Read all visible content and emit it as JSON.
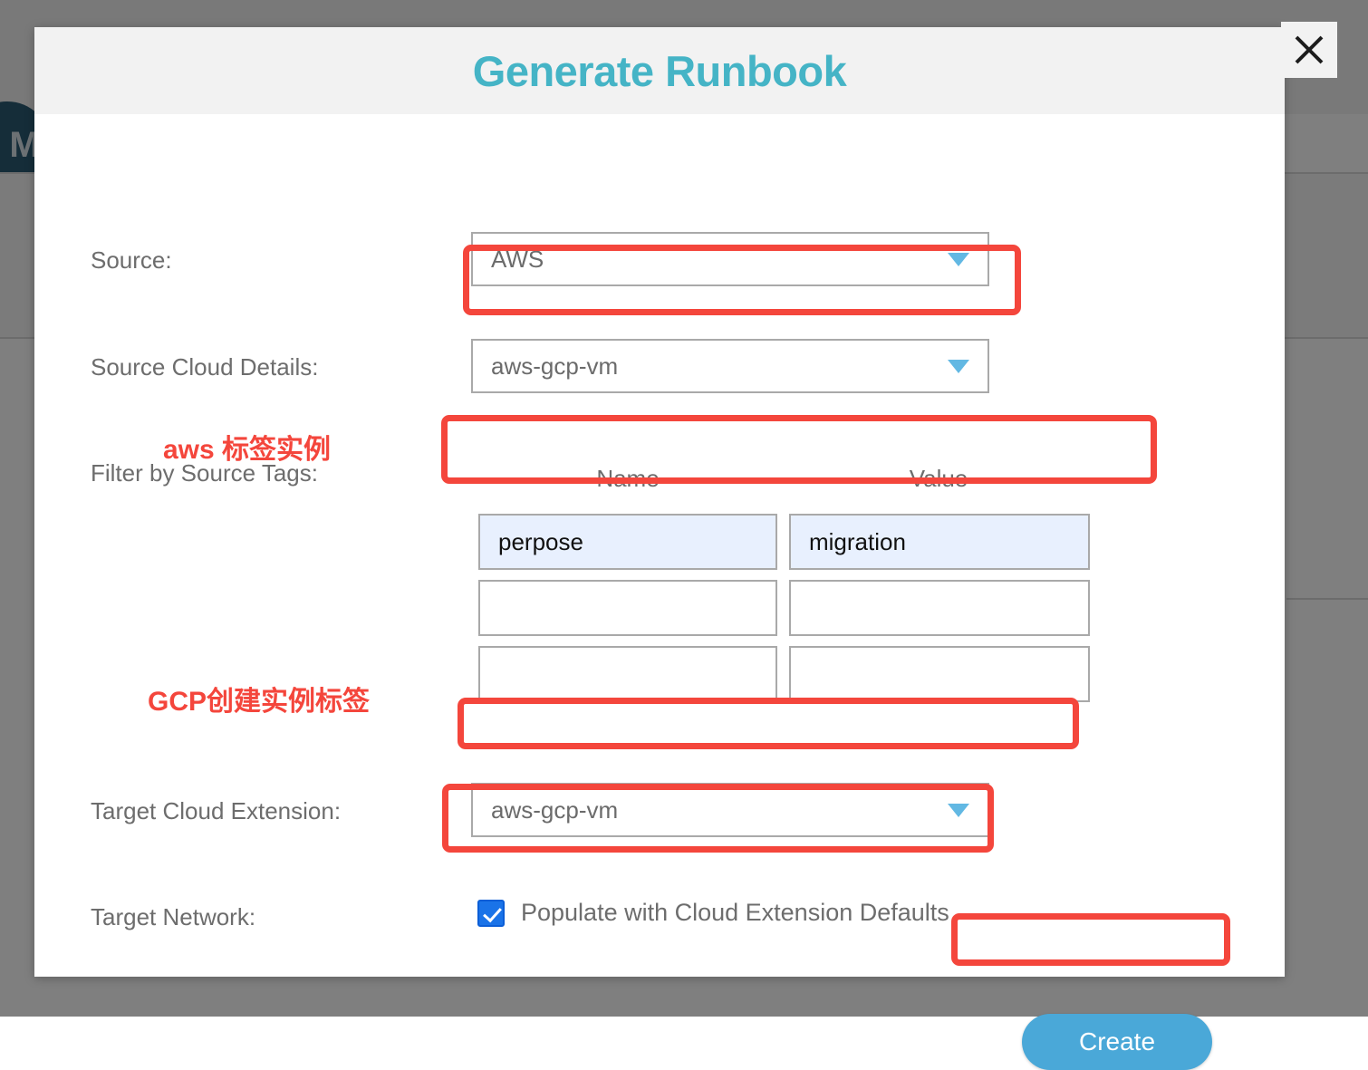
{
  "background": {
    "avatar_letter": "M"
  },
  "modal": {
    "title": "Generate Runbook",
    "close_icon": "close-icon",
    "fields": {
      "source": {
        "label": "Source:",
        "value": "AWS",
        "caret_icon": "chevron-down-icon"
      },
      "source_cloud_details": {
        "label": "Source Cloud Details:",
        "value": "aws-gcp-vm",
        "caret_icon": "chevron-down-icon"
      },
      "filter_by_source_tags": {
        "label": "Filter by Source Tags:",
        "columns": {
          "name": "Name",
          "value": "Value"
        },
        "rows": [
          {
            "name": "perpose",
            "value": "migration",
            "filled": true
          },
          {
            "name": "",
            "value": "",
            "filled": false
          },
          {
            "name": "",
            "value": "",
            "filled": false
          }
        ]
      },
      "target_cloud_extension": {
        "label": "Target Cloud Extension:",
        "value": "aws-gcp-vm",
        "caret_icon": "chevron-down-icon"
      },
      "target_network": {
        "label": "Target Network:",
        "checkbox_label": "Populate with Cloud Extension Defaults",
        "checked": true
      }
    },
    "create_button": "Create"
  },
  "annotations": {
    "aws_tag_note": "aws 标签实例",
    "gcp_tag_note": "GCP创建实例标签",
    "highlight_color": "#f4463c"
  },
  "colors": {
    "title": "#45b4c6",
    "primary_button": "#4aa8d8",
    "caret": "#62b8e3",
    "checkbox": "#1a73e8",
    "autofill_field": "#e8f0fe",
    "field_border": "#a9a9a9",
    "label_text": "#6d6d6d"
  }
}
